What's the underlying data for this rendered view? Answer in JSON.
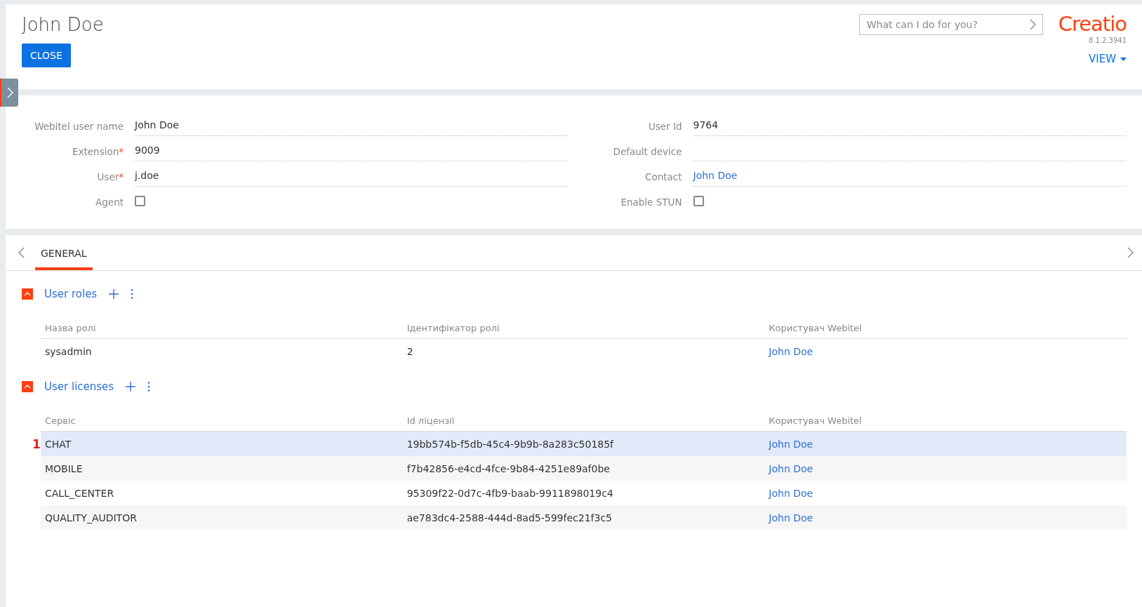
{
  "header": {
    "title": "John Doe",
    "close_button": "CLOSE",
    "search": {
      "placeholder": "What can I do for you?"
    },
    "logo": "Creatio",
    "version": "8.1.2.3941",
    "view_button": "VIEW"
  },
  "form": {
    "left": [
      {
        "kind": "text",
        "label": "Webitel user name",
        "value": "John Doe"
      },
      {
        "kind": "text",
        "label": "Extension",
        "required_mark": "*",
        "value": "9009"
      },
      {
        "kind": "text",
        "label": "User",
        "required_mark": "*",
        "value": "j.doe"
      },
      {
        "kind": "checkbox",
        "label": "Agent",
        "checked": false
      }
    ],
    "right": [
      {
        "kind": "text",
        "label": "User Id",
        "value": "9764"
      },
      {
        "kind": "text",
        "label": "Default device"
      },
      {
        "kind": "link",
        "label": "Contact",
        "value": "John Doe"
      },
      {
        "kind": "checkbox",
        "label": "Enable STUN",
        "checked": false
      }
    ]
  },
  "tabs": [
    {
      "label": "GENERAL",
      "selected": true
    }
  ],
  "details": [
    {
      "title": "User roles",
      "expanded": true,
      "columns": [
        "Назва ролі",
        "Ідентифікатор ролі",
        "Користувач Webitel"
      ],
      "rows": [
        {
          "selected": false,
          "cells": [
            "sysadmin",
            "2",
            "John Doe"
          ]
        }
      ]
    },
    {
      "title": "User licenses",
      "expanded": true,
      "columns": [
        "Сервіс",
        "Id ліцензії",
        "Користувач Webitel"
      ],
      "rows": [
        {
          "selected": true,
          "marker": "1",
          "cells": [
            "CHAT",
            "19bb574b-f5db-45c4-9b9b-8a283c50185f",
            "John Doe"
          ]
        },
        {
          "selected": false,
          "cells": [
            "MOBILE",
            "f7b42856-e4cd-4fce-9b84-4251e89af0be",
            "John Doe"
          ]
        },
        {
          "selected": false,
          "cells": [
            "CALL_CENTER",
            "95309f22-0d7c-4fb9-baab-9911898019c4",
            "John Doe"
          ]
        },
        {
          "selected": false,
          "cells": [
            "QUALITY_AUDITOR",
            "ae783dc4-2588-444d-8ad5-599fec21f3c5",
            "John Doe"
          ]
        }
      ]
    }
  ]
}
